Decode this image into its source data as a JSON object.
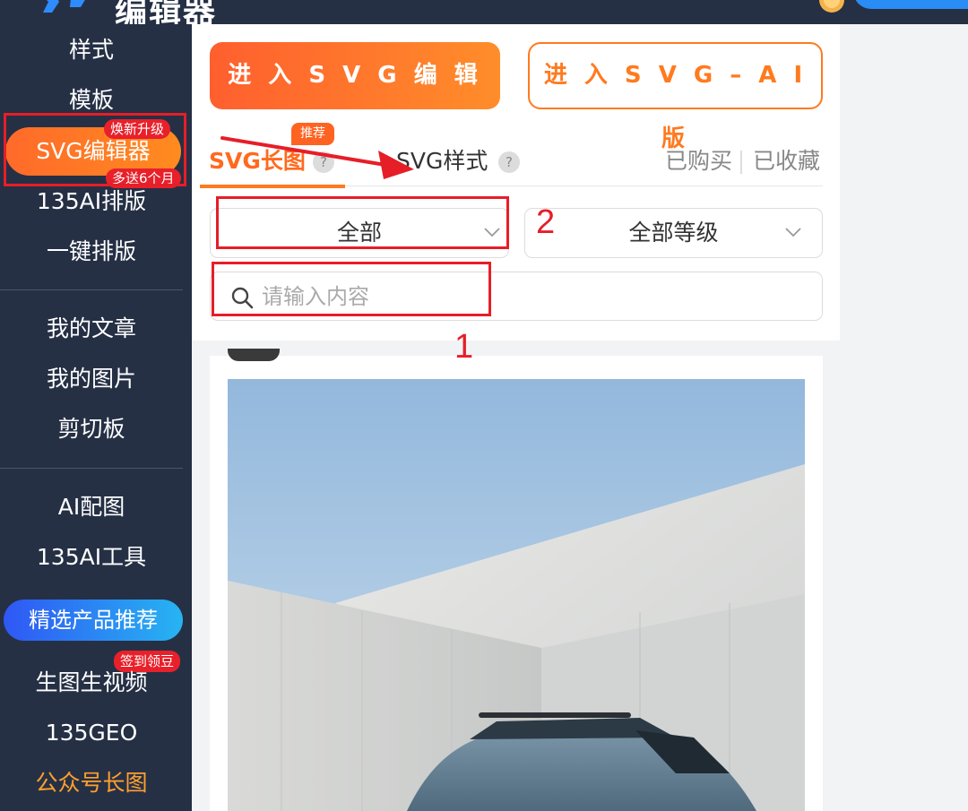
{
  "app": {
    "logo_text": "编辑器",
    "accent": "#ff6a1f",
    "sidebar_bg": "#253045"
  },
  "sidebar": {
    "items": [
      {
        "label": "样式"
      },
      {
        "label": "模板"
      },
      {
        "label": "SVG编辑器",
        "badge_top": "焕新升级",
        "badge_bottom": "多送6个月",
        "active": true
      },
      {
        "label": "135AI排版"
      },
      {
        "label": "一键排版"
      },
      {
        "label": "我的文章"
      },
      {
        "label": "我的图片"
      },
      {
        "label": "剪切板"
      },
      {
        "label": "AI配图"
      },
      {
        "label": "135AI工具"
      },
      {
        "label": "精选产品推荐",
        "style": "promo"
      },
      {
        "label": "生图生视频",
        "badge": "签到领豆"
      },
      {
        "label": "135GEO"
      },
      {
        "label": "公众号长图",
        "color": "#ff9f2e"
      }
    ]
  },
  "actions": {
    "enter_svg_editor": "进 入 S V G 编 辑 器",
    "enter_svg_ai": "进 入 S V G – A I 版"
  },
  "tabs": {
    "active": "SVG长图",
    "active_badge": "推荐",
    "other": "SVG样式",
    "help": "?",
    "purchased": "已购买",
    "favorites": "已收藏"
  },
  "filters": {
    "category": "全部",
    "level": "全部等级"
  },
  "search": {
    "placeholder": "请输入内容",
    "value": ""
  },
  "annotations": {
    "label_1": "1",
    "label_2": "2"
  },
  "card": {
    "image": "photo of blue SUV in front of white concrete walls under blue sky"
  }
}
